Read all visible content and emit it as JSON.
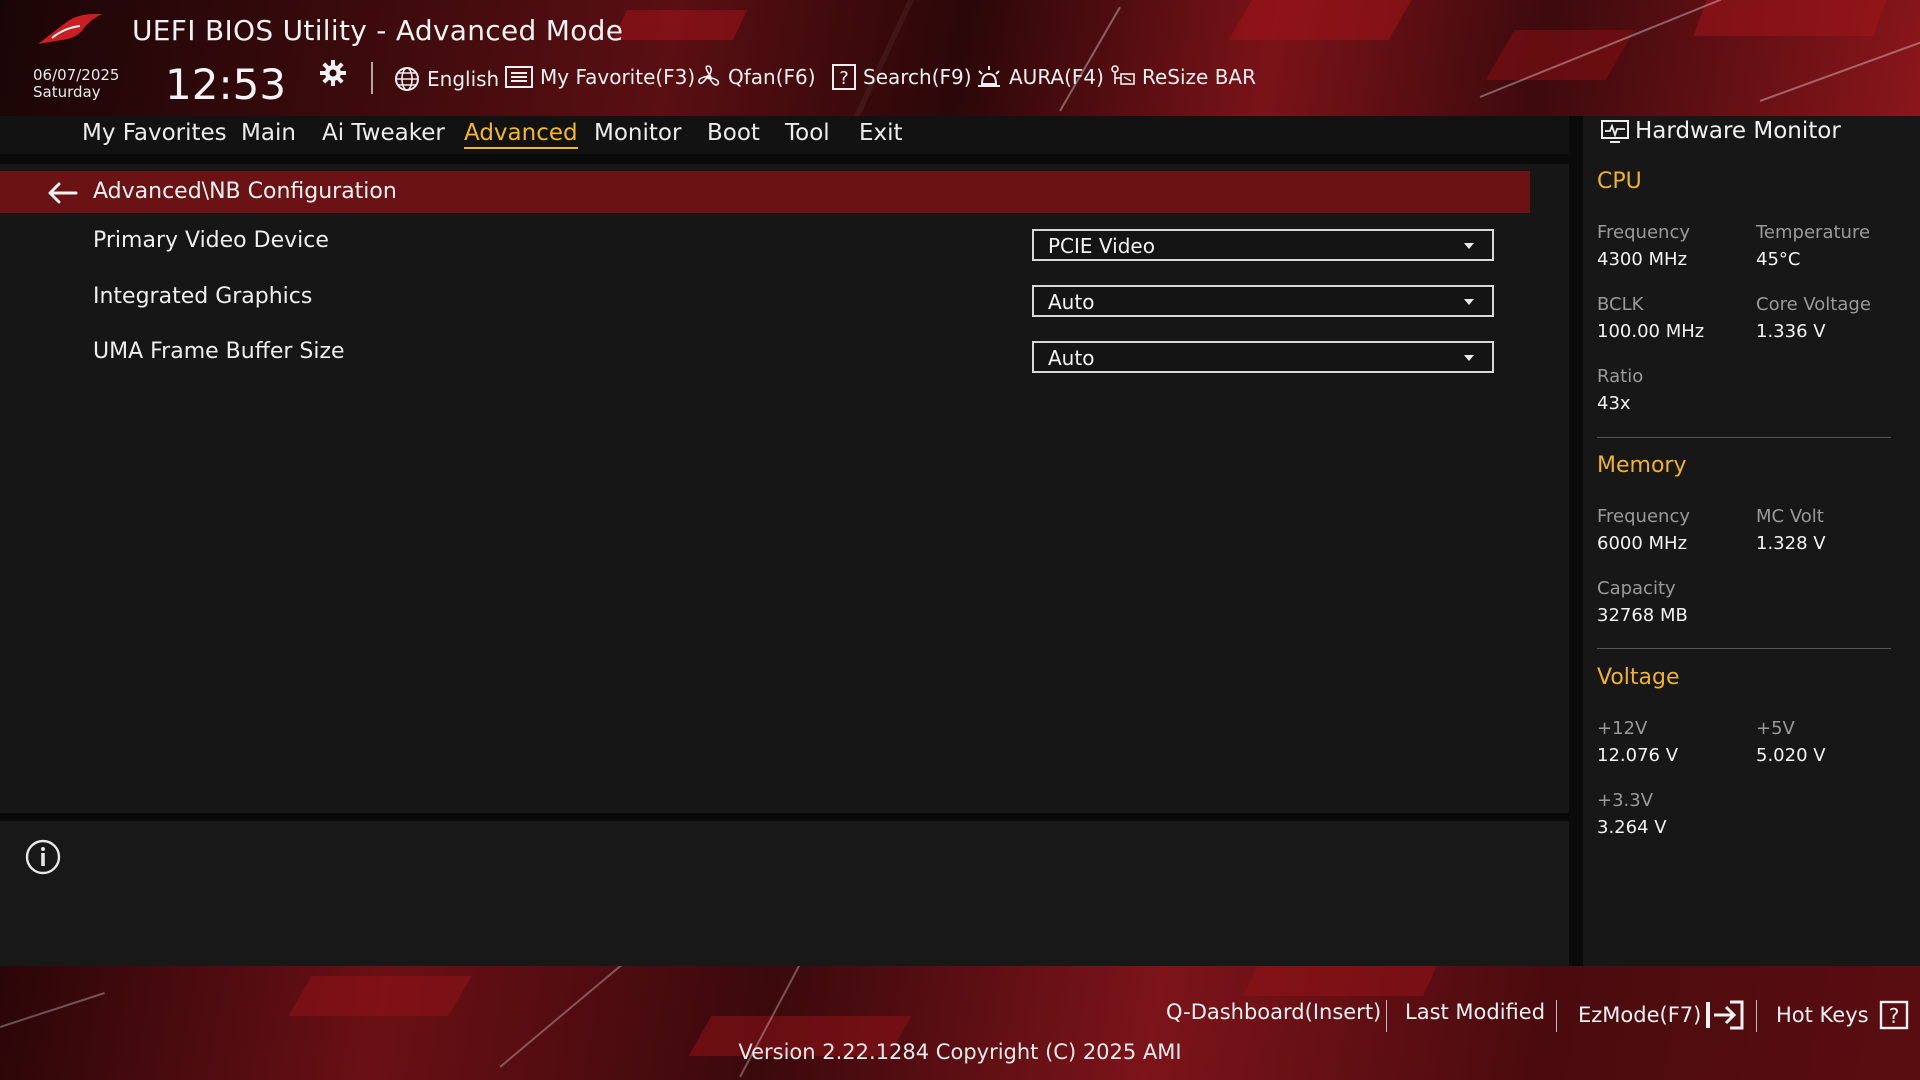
{
  "header": {
    "title": "UEFI BIOS Utility - Advanced Mode",
    "date": "06/07/2025",
    "day": "Saturday",
    "time": "12:53",
    "toolbar": [
      {
        "icon": "globe-icon",
        "label": "English"
      },
      {
        "icon": "favorite-list-icon",
        "label": "My Favorite(F3)"
      },
      {
        "icon": "fan-icon",
        "label": "Qfan(F6)"
      },
      {
        "icon": "search-help-icon",
        "label": "Search(F9)"
      },
      {
        "icon": "aura-light-icon",
        "label": "AURA(F4)"
      },
      {
        "icon": "resize-bar-icon",
        "label": "ReSize BAR"
      }
    ]
  },
  "nav": {
    "tabs": [
      {
        "label": "My Favorites",
        "active": false
      },
      {
        "label": "Main",
        "active": false
      },
      {
        "label": "Ai Tweaker",
        "active": false
      },
      {
        "label": "Advanced",
        "active": true
      },
      {
        "label": "Monitor",
        "active": false
      },
      {
        "label": "Boot",
        "active": false
      },
      {
        "label": "Tool",
        "active": false
      },
      {
        "label": "Exit",
        "active": false
      }
    ]
  },
  "breadcrumb": "Advanced\\NB Configuration",
  "settings": [
    {
      "label": "Primary Video Device",
      "value": "PCIE Video"
    },
    {
      "label": "Integrated Graphics",
      "value": "Auto"
    },
    {
      "label": "UMA Frame Buffer Size",
      "value": "Auto"
    }
  ],
  "hardware_monitor": {
    "title": "Hardware Monitor",
    "cpu": {
      "heading": "CPU",
      "frequency_label": "Frequency",
      "frequency": "4300 MHz",
      "temperature_label": "Temperature",
      "temperature": "45°C",
      "bclk_label": "BCLK",
      "bclk": "100.00 MHz",
      "core_voltage_label": "Core Voltage",
      "core_voltage": "1.336 V",
      "ratio_label": "Ratio",
      "ratio": "43x"
    },
    "memory": {
      "heading": "Memory",
      "frequency_label": "Frequency",
      "frequency": "6000 MHz",
      "mc_volt_label": "MC Volt",
      "mc_volt": "1.328 V",
      "capacity_label": "Capacity",
      "capacity": "32768 MB"
    },
    "voltage": {
      "heading": "Voltage",
      "v12_label": "+12V",
      "v12": "12.076 V",
      "v5_label": "+5V",
      "v5": "5.020 V",
      "v33_label": "+3.3V",
      "v33": "3.264 V"
    }
  },
  "footer": {
    "q_dashboard": "Q-Dashboard(Insert)",
    "last_modified": "Last Modified",
    "ezmode": "EzMode(F7)",
    "hot_keys": "Hot Keys",
    "version": "Version 2.22.1284 Copyright (C) 2025 AMI"
  },
  "colors": {
    "accent": "#f5b81e",
    "breadcrumb_bg": "#6b1214",
    "brand_red": "#8a161b"
  }
}
